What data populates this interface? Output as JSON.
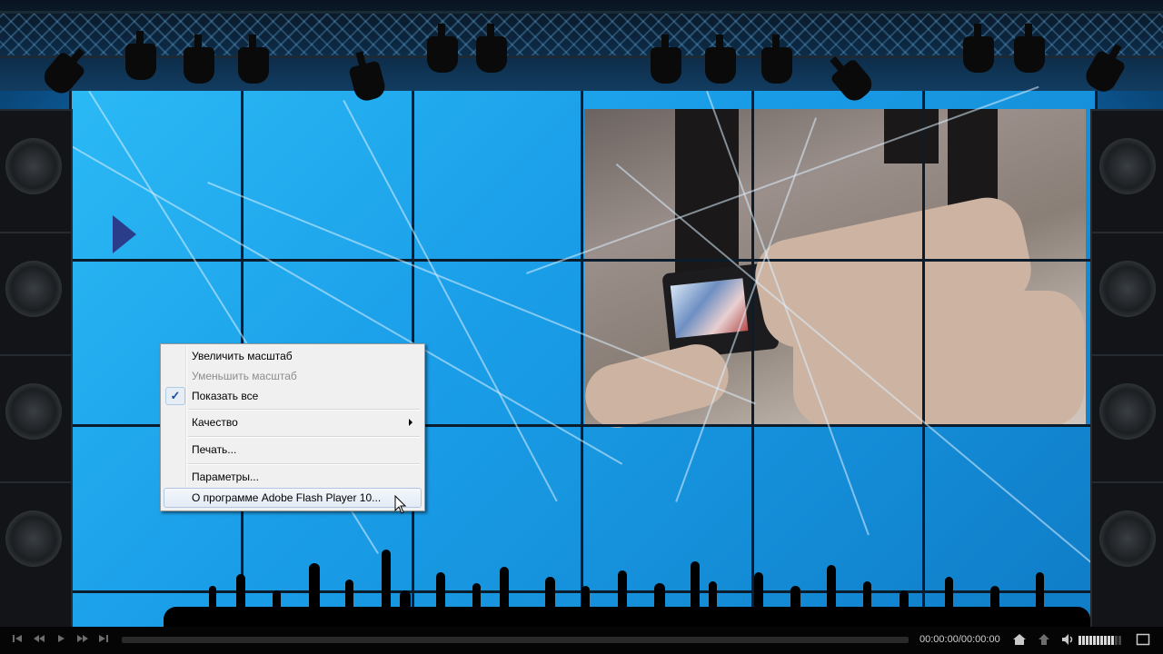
{
  "context_menu": {
    "items": [
      {
        "label": "Увеличить масштаб",
        "enabled": true
      },
      {
        "label": "Уменьшить масштаб",
        "enabled": false
      },
      {
        "label": "Показать все",
        "enabled": true,
        "checked": true
      },
      {
        "label": "Качество",
        "enabled": true,
        "submenu": true
      },
      {
        "label": "Печать...",
        "enabled": true
      },
      {
        "label": "Параметры...",
        "enabled": true
      },
      {
        "label": "О программе Adobe Flash Player 10...",
        "enabled": true,
        "highlighted": true
      }
    ],
    "check_mark": "✓"
  },
  "player": {
    "time": "00:00:00/00:00:00",
    "seek_progress": 0,
    "volume_level": 0.8,
    "icons": [
      "skip-start-icon",
      "rewind-icon",
      "play-icon",
      "fast-forward-icon",
      "skip-end-icon",
      "home-icon",
      "up-icon",
      "volume-icon",
      "fullscreen-icon"
    ]
  },
  "colors": {
    "screen_blue": "#1a9ee8",
    "menu_bg": "#f0f0f0",
    "menu_highlight_border": "#aec6e3",
    "control_bar": "#050505"
  }
}
